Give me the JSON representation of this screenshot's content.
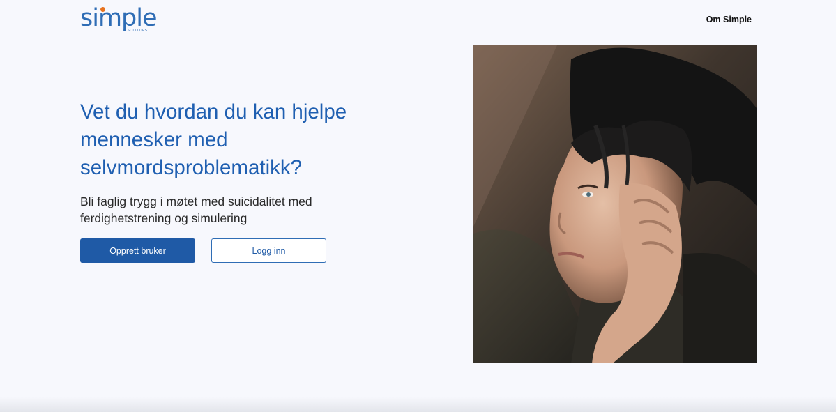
{
  "header": {
    "logo_text": "simple",
    "logo_subtext": "© SOLLI DPS",
    "nav_link_label": "Om Simple"
  },
  "hero": {
    "title": "Vet du hvordan du kan hjelpe mennesker med selvmordsproblematikk?",
    "subtitle": "Bli faglig trygg i møtet med suicidalitet med ferdighetstrening og simulering",
    "primary_button_label": "Opprett bruker",
    "secondary_button_label": "Logg inn"
  },
  "colors": {
    "brand_blue": "#1f5fb1",
    "button_blue": "#1f5aa6",
    "logo_accent": "#e8731f",
    "page_background": "#f7f8fd"
  }
}
